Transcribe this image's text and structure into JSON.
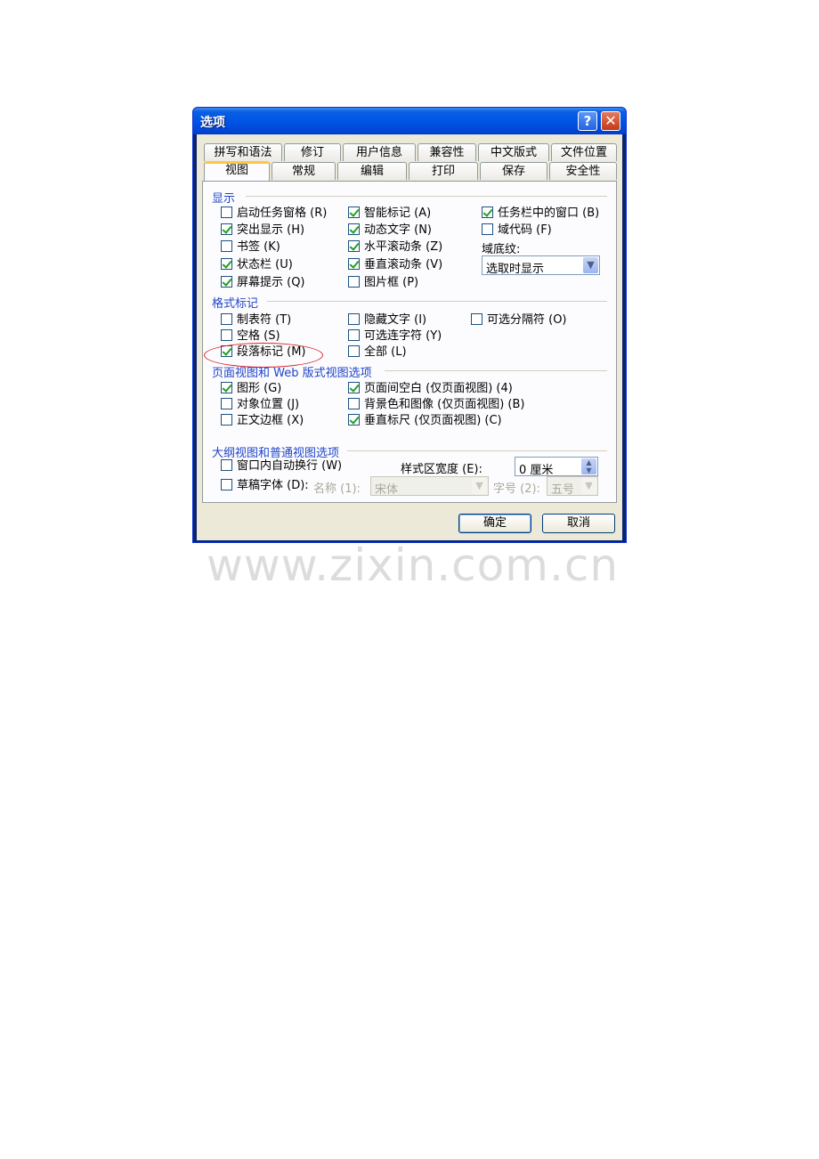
{
  "dialog": {
    "title": "选项",
    "help_label": "?",
    "close_label": "✕",
    "tabs_row1": [
      "拼写和语法",
      "修订",
      "用户信息",
      "兼容性",
      "中文版式",
      "文件位置"
    ],
    "tabs_row2": [
      "视图",
      "常规",
      "编辑",
      "打印",
      "保存",
      "安全性"
    ],
    "active_tab": "视图"
  },
  "display": {
    "heading": "显示",
    "startup_task_pane": {
      "label": "启动任务窗格 (R)",
      "checked": false
    },
    "smart_tags": {
      "label": "智能标记 (A)",
      "checked": true
    },
    "windows_in_taskbar": {
      "label": "任务栏中的窗口 (B)",
      "checked": true
    },
    "highlight": {
      "label": "突出显示 (H)",
      "checked": true
    },
    "animated_text": {
      "label": "动态文字 (N)",
      "checked": true
    },
    "field_codes": {
      "label": "域代码 (F)",
      "checked": false
    },
    "bookmarks": {
      "label": "书签 (K)",
      "checked": false
    },
    "horizontal_scroll": {
      "label": "水平滚动条 (Z)",
      "checked": true
    },
    "field_shading_label": "域底纹:",
    "field_shading_value": "选取时显示",
    "status_bar": {
      "label": "状态栏 (U)",
      "checked": true
    },
    "vertical_scroll": {
      "label": "垂直滚动条 (V)",
      "checked": true
    },
    "screentips": {
      "label": "屏幕提示 (Q)",
      "checked": true
    },
    "picture_placeholders": {
      "label": "图片框 (P)",
      "checked": false
    }
  },
  "formatting_marks": {
    "heading": "格式标记",
    "tab_chars": {
      "label": "制表符 (T)",
      "checked": false
    },
    "hidden_text": {
      "label": "隐藏文字 (I)",
      "checked": false
    },
    "optional_breaks": {
      "label": "可选分隔符 (O)",
      "checked": false
    },
    "spaces": {
      "label": "空格 (S)",
      "checked": false
    },
    "optional_hyphens": {
      "label": "可选连字符 (Y)",
      "checked": false
    },
    "paragraph_marks": {
      "label": "段落标记 (M)",
      "checked": true
    },
    "all": {
      "label": "全部 (L)",
      "checked": false
    }
  },
  "print_layout": {
    "heading": "页面视图和 Web 版式视图选项",
    "drawings": {
      "label": "图形 (G)",
      "checked": true
    },
    "white_space": {
      "label": "页面间空白 (仅页面视图) (4)",
      "checked": true
    },
    "object_anchors": {
      "label": "对象位置 (J)",
      "checked": false
    },
    "background": {
      "label": "背景色和图像 (仅页面视图) (B)",
      "checked": false
    },
    "text_boundaries": {
      "label": "正文边框 (X)",
      "checked": false
    },
    "vertical_ruler": {
      "label": "垂直标尺 (仅页面视图) (C)",
      "checked": true
    }
  },
  "outline_normal": {
    "heading": "大纲视图和普通视图选项",
    "wrap_window": {
      "label": "窗口内自动换行 (W)",
      "checked": false
    },
    "style_area_label": "样式区宽度 (E):",
    "style_area_value": "0 厘米",
    "draft_font": {
      "label": "草稿字体 (D):",
      "checked": false
    },
    "name_label": "名称 (1):",
    "name_value": "宋体",
    "size_label": "字号 (2):",
    "size_value": "五号"
  },
  "buttons": {
    "ok": "确定",
    "cancel": "取消"
  },
  "watermark": "www.zixin.com.cn"
}
